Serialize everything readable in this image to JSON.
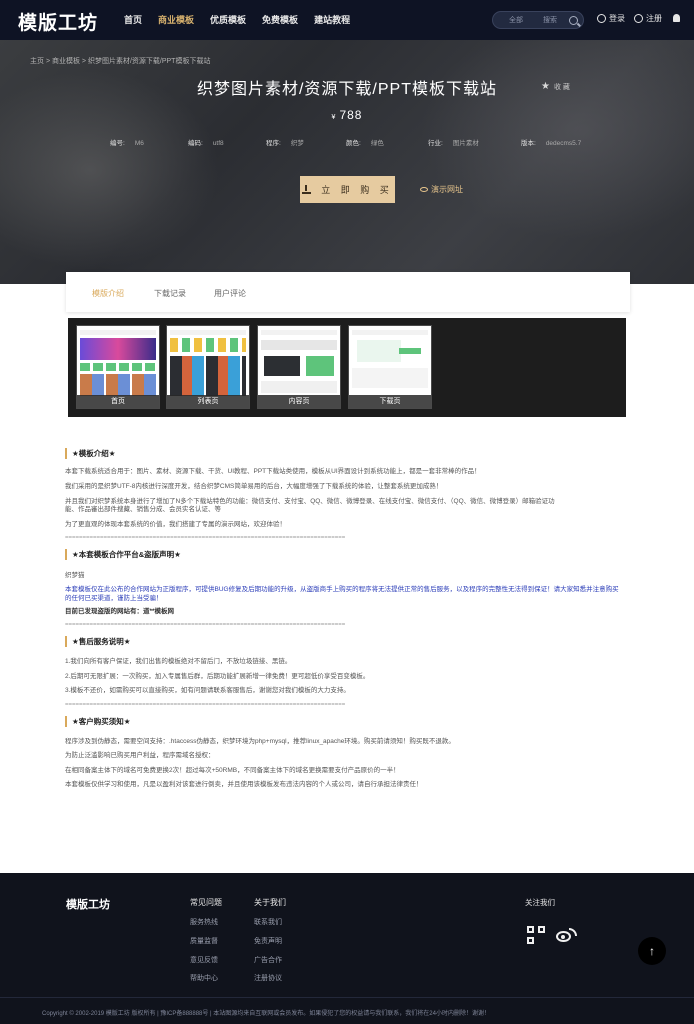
{
  "header": {
    "logo": "模版工坊",
    "nav": [
      "首页",
      "商业模板",
      "优质模板",
      "免费模板",
      "建站教程"
    ],
    "active_nav": "商业模板",
    "search_category": "全部",
    "search_placeholder": "搜索",
    "login": "登录",
    "register": "注册"
  },
  "hero": {
    "breadcrumb": "主页 > 商业模板 > 织梦图片素材/资源下载/PPT模板下载站",
    "title": "织梦图片素材/资源下载/PPT模板下载站",
    "favorite": "收 藏",
    "currency": "¥",
    "price": "788",
    "specs": [
      {
        "k": "编号:",
        "v": "M6"
      },
      {
        "k": "编码:",
        "v": "utf8"
      },
      {
        "k": "程序:",
        "v": "织梦"
      },
      {
        "k": "颜色:",
        "v": "绿色"
      },
      {
        "k": "行业:",
        "v": "图片素材"
      },
      {
        "k": "版本:",
        "v": "dedecms5.7"
      }
    ],
    "buy_button": "立 即 购 买",
    "demo_link": "演示网址"
  },
  "tabs": [
    "模版介绍",
    "下载记录",
    "用户评论"
  ],
  "active_tab": "模版介绍",
  "gallery": [
    "首页",
    "列表页",
    "内容页",
    "下载页"
  ],
  "article": {
    "s1_title": "★模板介绍★",
    "s1_p1": "本套下载系统适合用于：图片、素材、资源下载、干货、UI教程、PPT下载站类使用，模板从UI界面设计到系统功能上，都是一套非常棒的作品！",
    "s1_p2": "我们采用的是织梦UTF-8内核进行深度开发，结合织梦CMS简单易用的后台，大幅度增强了下载系统的体验，让整套系统更加成熟！",
    "s1_p3": "并且我们对织梦系统本身进行了增加了N多个下载站特色的功能：微信支付、支付宝、QQ、微信、微博登录、在线支付宝、微信支付、（QQ、微信、微博登录）邮箱验证功",
    "s1_p3b": "能、作品審出部件搜藏、销售分成、会员实名认证、等",
    "s1_p4": "为了更直观的体现本套系统的价值，我们搭建了专属的演示网站，欢迎体验！",
    "s2_title": "★本套模板合作平台&盗版声明★",
    "s2_p1": "织梦猫",
    "s2_p2": "本套模板仅在此公布的合作网站为正版程序，可提供BUG修复及后期功能的升级，从盗版商手上购买的程序将无法提供正常的售后服务，以及程序的完整性无法得到保证！请大家知悉并注意购买的任何已买渠道，谨防上当受骗！",
    "s2_p3": "目前已发现盗版的网站有：道**模板网",
    "s3_title": "★售后服务说明★",
    "s3_p1": "1.我们向所有客户保证，我们出售的模板绝对不留后门，不放垃圾链接、黑链。",
    "s3_p2": "2.后期可无限扩展：一次购买，加入专属售后群，后期功能扩展新增一律免费！更可超低价享受百变模板。",
    "s3_p3": "3.模板不还价，如需购买可以直接购买，如有问题请联系客服售后，谢谢您对我们模板的大力支持。",
    "s4_title": "★客户购买须知★",
    "s4_p1": "程序涉及到伪静态，需要空间支持：.htaccess伪静态，织梦环境为php+mysql，推荐linux_apache环境。购买前请须知！购买既不退款。",
    "s4_p2": "为防止泛滥影响已购买用户利益，程序需域名授权：",
    "s4_p3": "在相同备案主体下的域名可免费更换2次！超过每次+50RMB，不同备案主体下的域名更换需要支付产品原价的一半！",
    "s4_p4": "本套模板仅供学习和使用，凡是以盈利对该套进行倒卖，并且使用该模板发布违法内容的个人或公司，请自行承担法律责任！",
    "divider_text": "================================================================================"
  },
  "footer": {
    "logo": "模版工坊",
    "col1_title": "常见问题",
    "col1_links": [
      "服务热线",
      "质量监督",
      "意见反馈",
      "帮助中心"
    ],
    "col2_title": "关于我们",
    "col2_links": [
      "联系我们",
      "免责声明",
      "广告合作",
      "注册协议"
    ],
    "follow": "关注我们",
    "to_top": "↑",
    "copyright": "Copyright © 2002-2019 模版工坊 版权所有 | 豫ICP备888888号 | 本站图源均来自互联网或会员发布。如果侵犯了您的权益请与我们联系，我们将在24小时内删除！谢谢！"
  },
  "colors": {
    "header_bg": "#0e1324",
    "accent": "#d9a95b",
    "buy_button": "#e6cba0",
    "footer_bg": "#10131c"
  }
}
